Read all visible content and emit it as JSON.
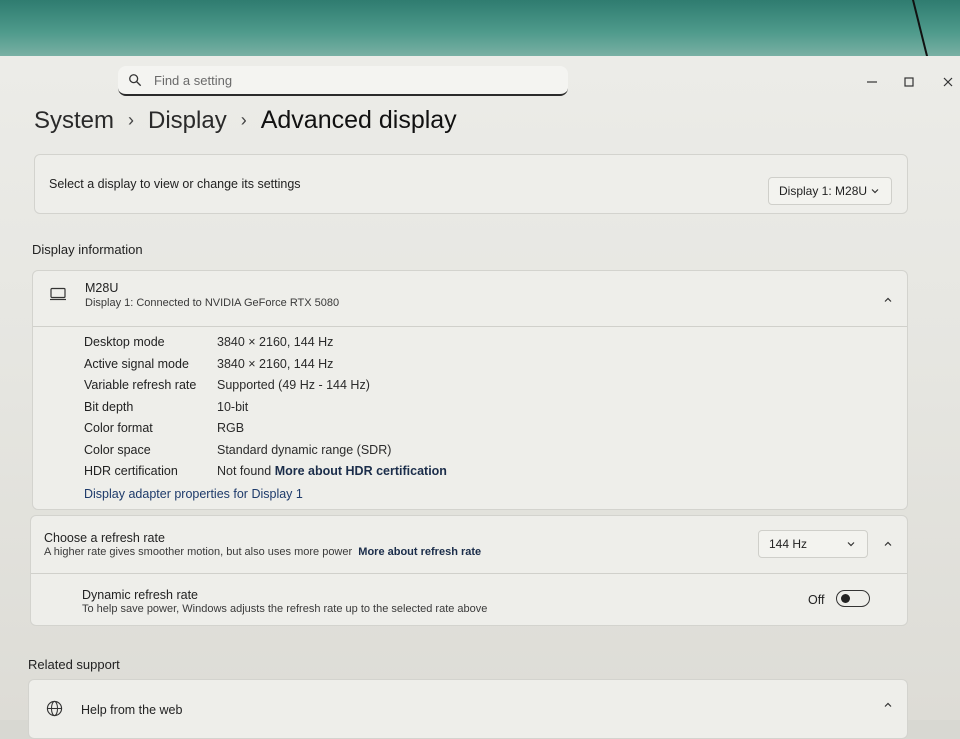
{
  "search": {
    "placeholder": "Find a setting"
  },
  "breadcrumb": {
    "level1": "System",
    "level2": "Display",
    "current": "Advanced display"
  },
  "select_display": {
    "label": "Select a display to view or change its settings",
    "selected": "Display 1: M28U"
  },
  "display_info": {
    "section_title": "Display information",
    "monitor_name": "M28U",
    "connection": "Display 1: Connected to NVIDIA GeForce RTX 5080",
    "rows": [
      {
        "label": "Desktop mode",
        "value": "3840 × 2160, 144 Hz"
      },
      {
        "label": "Active signal mode",
        "value": "3840 × 2160, 144 Hz"
      },
      {
        "label": "Variable refresh rate",
        "value": "Supported (49 Hz - 144 Hz)"
      },
      {
        "label": "Bit depth",
        "value": "10-bit"
      },
      {
        "label": "Color format",
        "value": "RGB"
      },
      {
        "label": "Color space",
        "value": "Standard dynamic range (SDR)"
      },
      {
        "label": "HDR certification",
        "value": "Not found",
        "link": "More about HDR certification"
      }
    ],
    "adapter_link": "Display adapter properties for Display 1"
  },
  "refresh_rate": {
    "title": "Choose a refresh rate",
    "description": "A higher rate gives smoother motion, but also uses more power",
    "link": "More about refresh rate",
    "selected": "144 Hz"
  },
  "dynamic_refresh": {
    "title": "Dynamic refresh rate",
    "description": "To help save power, Windows adjusts the refresh rate up to the selected rate above",
    "state_label": "Off",
    "enabled": false
  },
  "related_support": {
    "section_title": "Related support",
    "help_item": "Help from the web"
  }
}
